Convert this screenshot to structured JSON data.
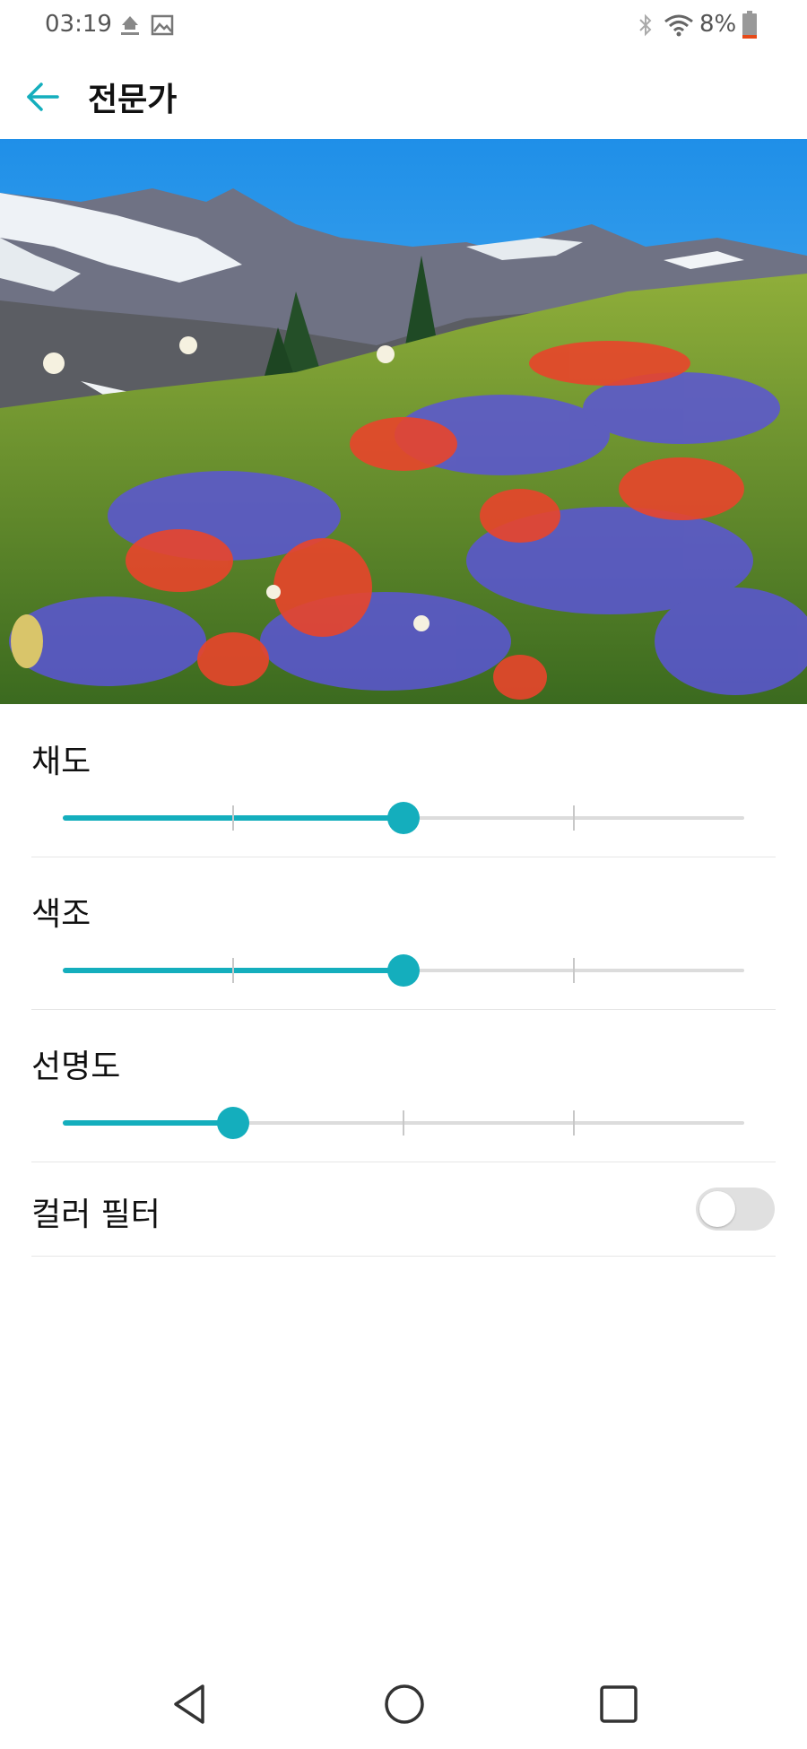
{
  "status_bar": {
    "time": "03:19",
    "upload_icon": "upload-icon",
    "gallery_icon": "image-icon",
    "bluetooth_icon": "bluetooth-icon",
    "wifi_icon": "wifi-icon",
    "battery_text": "8%",
    "battery_color": "#e64a19"
  },
  "app_bar": {
    "back_icon": "back-arrow-icon",
    "title": "전문가",
    "accent_color": "#14aebd"
  },
  "settings": {
    "saturation": {
      "label": "채도",
      "value": 0.5
    },
    "hue": {
      "label": "색조",
      "value": 0.5
    },
    "sharpness": {
      "label": "선명도",
      "value": 0.25
    },
    "color_filter": {
      "label": "컬러 필터",
      "enabled": false
    }
  },
  "nav_bar": {
    "back_icon": "nav-back-icon",
    "home_icon": "nav-home-icon",
    "recents_icon": "nav-recents-icon"
  }
}
